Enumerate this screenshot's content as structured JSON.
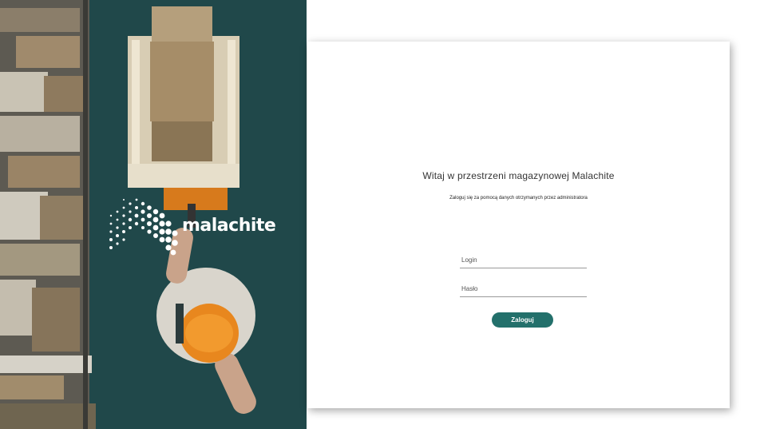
{
  "brand": {
    "name": "malachite",
    "accent_color": "#23706b"
  },
  "login_card": {
    "welcome": "Witaj w przestrzeni magazynowej Malachite",
    "subtitle": "Zaloguj się za pomocą danych otrzymanych przez administratora",
    "login_placeholder": "Login",
    "password_placeholder": "Hasło",
    "submit_label": "Zaloguj"
  }
}
